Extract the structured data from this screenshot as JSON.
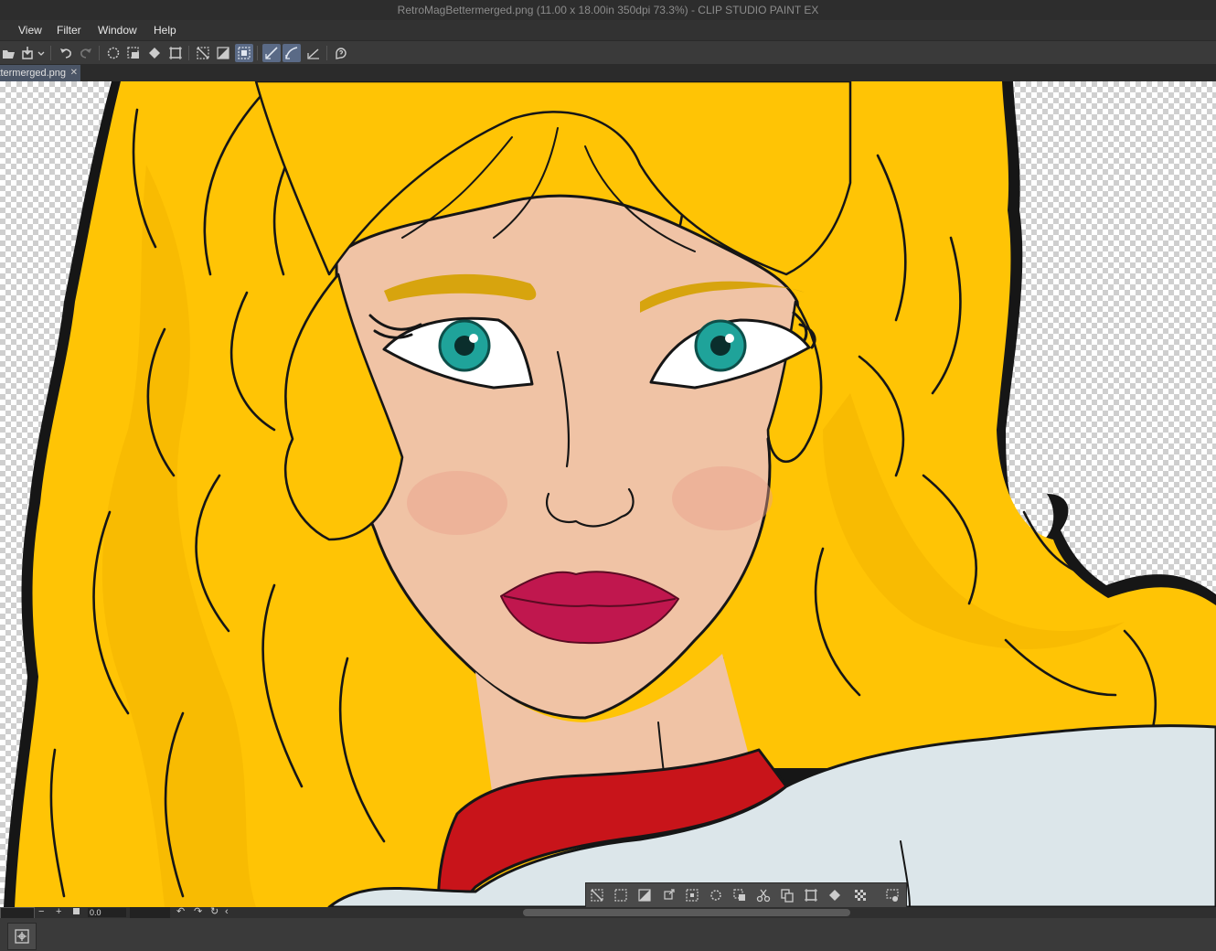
{
  "window": {
    "title": "RetroMagBettermerged.png (11.00 x 18.00in 350dpi 73.3%) - CLIP STUDIO PAINT EX"
  },
  "menu": [
    "View",
    "Filter",
    "Window",
    "Help"
  ],
  "toolbar": {
    "icons": [
      "open-file-icon",
      "save-icon",
      "dropdown-chevron-icon",
      "undo-icon",
      "redo-icon",
      "clear-selection-icon",
      "select-layer-icon",
      "fill-icon",
      "transform-icon",
      "deselect-icon",
      "invert-selection-icon",
      "show-selection-icon",
      "snap-ruler-icon",
      "snap-special-ruler-icon",
      "snap-grid-icon",
      "help-icon"
    ]
  },
  "tab": {
    "label": "RetroMagBettermerged.png",
    "close": "✕"
  },
  "statusbar": {
    "minus": "−",
    "plus": "+",
    "zoom_value": "0.0"
  },
  "selection_launcher": {
    "icons": [
      "deselect-icon",
      "select-all-icon",
      "invert-icon",
      "expand-icon",
      "shrink-icon",
      "magic-wand-icon",
      "copy-paste-icon",
      "cut-icon",
      "copy-icon",
      "transform-icon",
      "fill-icon",
      "pattern-icon",
      "settings-icon"
    ]
  },
  "colors": {
    "hair": "#FFC405",
    "skin": "#F0C3A5",
    "lips": "#C0174E",
    "collar": "#C8141A",
    "shirt": "#DCE6EA",
    "eyes": "#1FA39A",
    "outline": "#161616",
    "brow": "#D7A40E"
  }
}
